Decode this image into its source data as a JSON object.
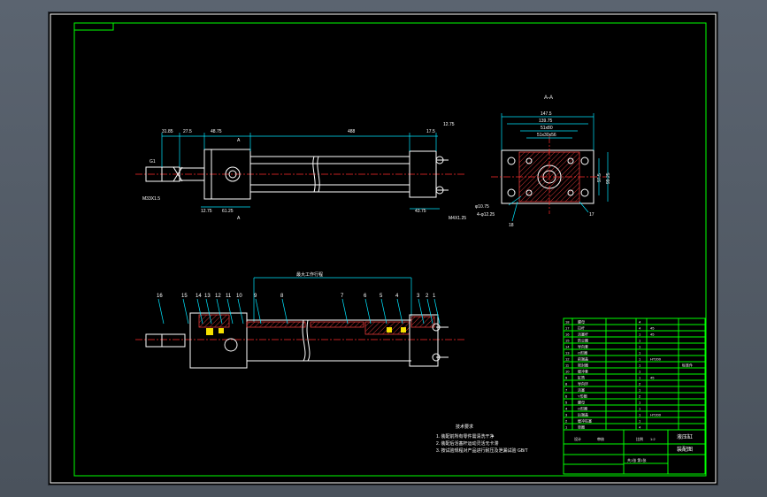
{
  "section_label": "A-A",
  "dims_front": {
    "d1": "31.85",
    "d2": "27.5",
    "d3": "48.75",
    "d4": "488",
    "d5": "17.5",
    "d6": "12.75",
    "d7": "61.25",
    "d8": "12.75",
    "d9": "43.75",
    "d10": "M33X1.5",
    "d11": "M4X1.25",
    "d12": "G1",
    "a1": "A",
    "a2": "A"
  },
  "dims_side": {
    "w1": "147.5",
    "w2": "139.75",
    "w3": "51x80",
    "w4": "51x30x56",
    "h1": "97.5",
    "h2": "99.25",
    "c1": "φ10.75",
    "c2": "4-φ12.25",
    "n17": "17",
    "n18": "18"
  },
  "section_view_label": "最大工作行程",
  "part_numbers": [
    "16",
    "15",
    "14",
    "13",
    "12",
    "11",
    "10",
    "9",
    "8",
    "7",
    "6",
    "5",
    "4",
    "3",
    "2",
    "1"
  ],
  "notes": {
    "heading": "技术要求",
    "items": [
      "1. 装配前所有零件需清洗干净",
      "2. 装配后活塞杆运动灵活无卡滞",
      "3. 按试验规程对产品进行耐压及泄漏试验 GB/T"
    ]
  },
  "title_block": {
    "rows": [
      {
        "no": "18",
        "name": "螺母",
        "qty": "4",
        "mat": "",
        "note": ""
      },
      {
        "no": "17",
        "name": "拉杆",
        "qty": "4",
        "mat": "45",
        "note": ""
      },
      {
        "no": "16",
        "name": "活塞杆",
        "qty": "1",
        "mat": "45",
        "note": ""
      },
      {
        "no": "15",
        "name": "防尘圈",
        "qty": "1",
        "mat": "",
        "note": ""
      },
      {
        "no": "14",
        "name": "导向套",
        "qty": "1",
        "mat": "",
        "note": ""
      },
      {
        "no": "13",
        "name": "O形圈",
        "qty": "1",
        "mat": "",
        "note": ""
      },
      {
        "no": "12",
        "name": "前端盖",
        "qty": "1",
        "mat": "HT200",
        "note": ""
      },
      {
        "no": "11",
        "name": "密封圈",
        "qty": "1",
        "mat": "",
        "note": "标准件"
      },
      {
        "no": "10",
        "name": "缓冲套",
        "qty": "1",
        "mat": "",
        "note": ""
      },
      {
        "no": "9",
        "name": "缸筒",
        "qty": "1",
        "mat": "45",
        "note": ""
      },
      {
        "no": "8",
        "name": "导向环",
        "qty": "2",
        "mat": "",
        "note": ""
      },
      {
        "no": "7",
        "name": "活塞",
        "qty": "1",
        "mat": "",
        "note": ""
      },
      {
        "no": "6",
        "name": "Y形圈",
        "qty": "2",
        "mat": "",
        "note": ""
      },
      {
        "no": "5",
        "name": "螺母",
        "qty": "1",
        "mat": "",
        "note": ""
      },
      {
        "no": "4",
        "name": "O形圈",
        "qty": "1",
        "mat": "",
        "note": ""
      },
      {
        "no": "3",
        "name": "后端盖",
        "qty": "1",
        "mat": "HT200",
        "note": ""
      },
      {
        "no": "2",
        "name": "缓冲柱塞",
        "qty": "1",
        "mat": "",
        "note": ""
      },
      {
        "no": "1",
        "name": "垫圈",
        "qty": "4",
        "mat": "",
        "note": ""
      }
    ],
    "scale_label": "比例",
    "scale_value": "1:2",
    "drawing_title": "液压缸",
    "drawing_no": "装配图",
    "designer": "设计",
    "checker": "审核",
    "sheet": "共1张 第1张"
  }
}
